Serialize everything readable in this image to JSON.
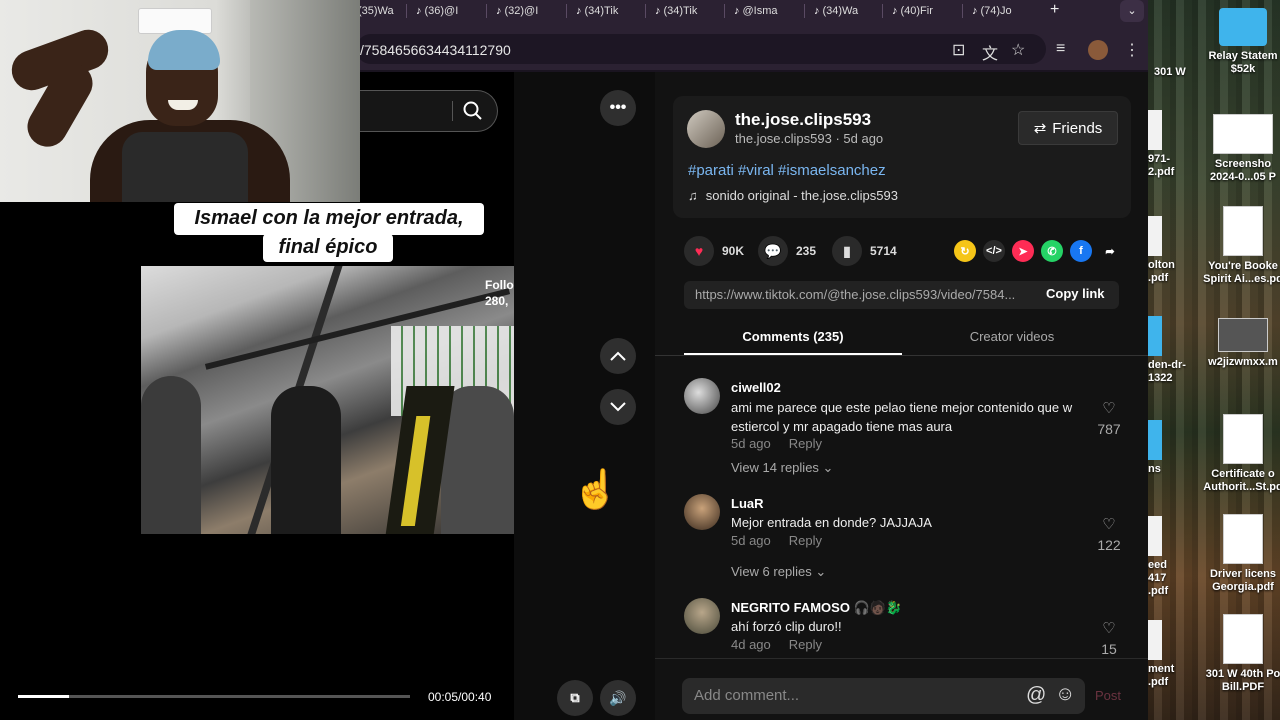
{
  "browser": {
    "tabs": [
      {
        "label": "(35)Wa"
      },
      {
        "label": "(36)@I"
      },
      {
        "label": "(32)@I"
      },
      {
        "label": "(34)Tik"
      },
      {
        "label": "(34)Tik"
      },
      {
        "label": "@Isma"
      },
      {
        "label": "(34)Wa"
      },
      {
        "label": "(40)Fir"
      },
      {
        "label": "(74)Jo"
      }
    ],
    "new_tab": "+",
    "url": "/7584656634434112790"
  },
  "video": {
    "caption_line1": "Ismael con la mejor entrada,",
    "caption_line2": "final épico",
    "follow_label": "Follo",
    "follow_count": "280,",
    "time": "00:05/00:40",
    "progress": 0.13
  },
  "post": {
    "username": "the.jose.clips593",
    "subline": "the.jose.clips593 · 5d ago",
    "friends_label": "Friends",
    "hashtags": "#parati #viral #ismaelsanchez",
    "sound": "sonido original - the.jose.clips593",
    "likes": "90K",
    "comments_count": "235",
    "saves": "5714",
    "link": "https://www.tiktok.com/@the.jose.clips593/video/7584...",
    "copy_link": "Copy link"
  },
  "tabs": {
    "comments": "Comments (235)",
    "creator": "Creator videos"
  },
  "comments": [
    {
      "name": "ciwell02",
      "text": "ami me parece que este pelao tiene mejor contenido que w estiercol y mr apagado tiene mas aura",
      "time": "5d ago",
      "reply": "Reply",
      "likes": "787",
      "replies": "View 14 replies"
    },
    {
      "name": "LuaR",
      "text": "Mejor entrada en donde? JAJJAJA",
      "time": "5d ago",
      "reply": "Reply",
      "likes": "122",
      "replies": "View 6 replies"
    },
    {
      "name": "NEGRITO FAMOSO 🎧🧑🏿🐉",
      "text": "ahí forzó clip duro!!",
      "time": "4d ago",
      "reply": "Reply",
      "likes": "15"
    }
  ],
  "comment_box": {
    "placeholder": "Add comment...",
    "post": "Post"
  },
  "desktop": {
    "items": [
      {
        "label": "Relay Statem $52k"
      },
      {
        "label": "Screensho 2024-0...05 P"
      },
      {
        "label": "You're Booke Spirit Ai...es.pd"
      },
      {
        "label": "w2jizwmxx.m"
      },
      {
        "label": "Certificate o Authorit...St.pd"
      },
      {
        "label": "Driver licens Georgia.pdf"
      },
      {
        "label": "301 W 40th Po Bill.PDF"
      }
    ],
    "left_labels": [
      "301 W",
      "971- 2.pdf",
      "olton .pdf",
      "den-dr- 1322",
      "ns",
      "eed 417 .pdf",
      "ment .pdf"
    ]
  }
}
